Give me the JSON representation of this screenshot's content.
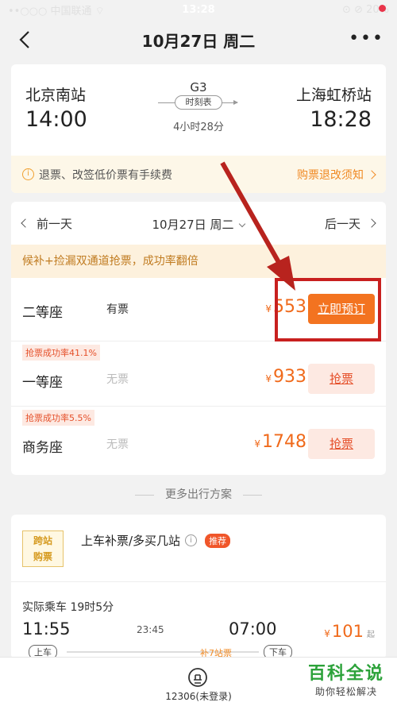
{
  "status_bar": {
    "carrier": "••○○○ 中国联通 ⌔",
    "time": "13:28",
    "battery": "⊙ ⊘ 20%"
  },
  "nav": {
    "title": "10月27日 周二",
    "more": "•••"
  },
  "train": {
    "from_station": "北京南站",
    "to_station": "上海虹桥站",
    "depart_time": "14:00",
    "arrive_time": "18:28",
    "train_no": "G3",
    "timetable_label": "时刻表",
    "duration": "4小时28分"
  },
  "notice": {
    "text": "退票、改签低价票有手续费",
    "link": "购票退改须知"
  },
  "date_nav": {
    "prev": "前一天",
    "current": "10月27日 周二",
    "next": "后一天"
  },
  "promo": "候补+捡漏双通道抢票，成功率翻倍",
  "seats": [
    {
      "name": "二等座",
      "stock": "有票",
      "price": "553",
      "button": "立即预订"
    },
    {
      "rate": "抢票成功率41.1%",
      "name": "一等座",
      "stock": "无票",
      "price": "933",
      "button": "抢票"
    },
    {
      "rate": "抢票成功率5.5%",
      "name": "商务座",
      "stock": "无票",
      "price": "1748",
      "button": "抢票"
    }
  ],
  "currency": "¥",
  "more_options_title": "更多出行方案",
  "extra": {
    "logo_line1": "跨站",
    "logo_line2": "购票",
    "title": "上车补票/多买几站",
    "info": "i",
    "badge": "推荐",
    "actual_ride": "实际乘车 19时5分",
    "depart": "11:55",
    "middle": "23:45",
    "arrive": "07:00",
    "price": "101",
    "price_suffix": "起",
    "label_board": "上车",
    "label_supplement": "补7站票",
    "label_alight": "下车"
  },
  "tabbar": {
    "label": "12306(未登录)"
  },
  "watermark": {
    "main": "百科全说",
    "sub": "助你轻松解决"
  },
  "colors": {
    "accent": "#f37320",
    "price": "#f06a1b",
    "highlight": "#c8201f",
    "promo_bg": "#fdf1dd"
  }
}
